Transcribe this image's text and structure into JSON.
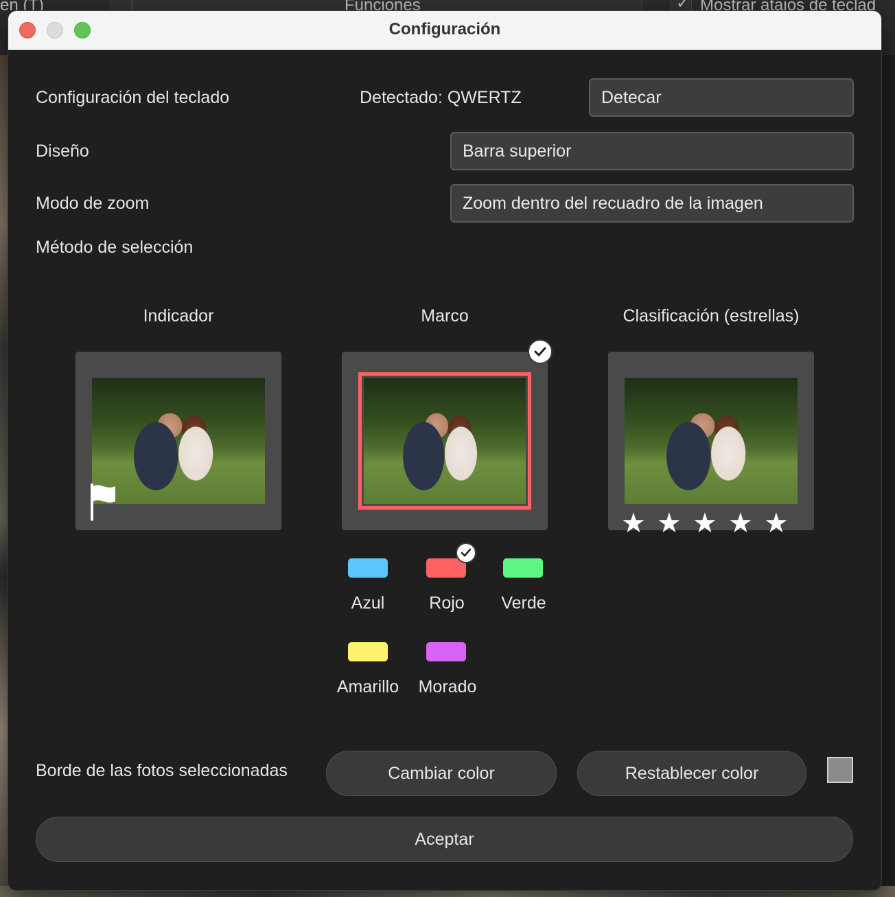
{
  "background": {
    "left_text": "en (T)",
    "middle_text": "Funciones",
    "right_text": "Mostrar atajos de teclad"
  },
  "window": {
    "title": "Configuración"
  },
  "keyboard": {
    "label": "Configuración del teclado",
    "detected": "Detectado: QWERTZ",
    "detect_button": "Detecar"
  },
  "layout": {
    "label": "Diseño",
    "value": "Barra superior"
  },
  "zoom": {
    "label": "Modo de zoom",
    "value": "Zoom dentro del recuadro de la imagen"
  },
  "selection": {
    "label": "Método de selección",
    "options": [
      {
        "label": "Indicador",
        "selected": false
      },
      {
        "label": "Marco",
        "selected": true
      },
      {
        "label": "Clasificación (estrellas)",
        "selected": false
      }
    ],
    "stars": 5
  },
  "colors": {
    "items": [
      {
        "label": "Azul",
        "hex": "#5ac8fa",
        "selected": false
      },
      {
        "label": "Rojo",
        "hex": "#ff6161",
        "selected": true
      },
      {
        "label": "Verde",
        "hex": "#5df784",
        "selected": false
      },
      {
        "label": "Amarillo",
        "hex": "#fef36a",
        "selected": false
      },
      {
        "label": "Morado",
        "hex": "#d863f4",
        "selected": false
      }
    ]
  },
  "border": {
    "label": "Borde de las fotos seleccionadas",
    "change_button": "Cambiar color",
    "reset_button": "Restablecer color",
    "current_color": "#8a8a8a"
  },
  "accept_button": "Aceptar"
}
